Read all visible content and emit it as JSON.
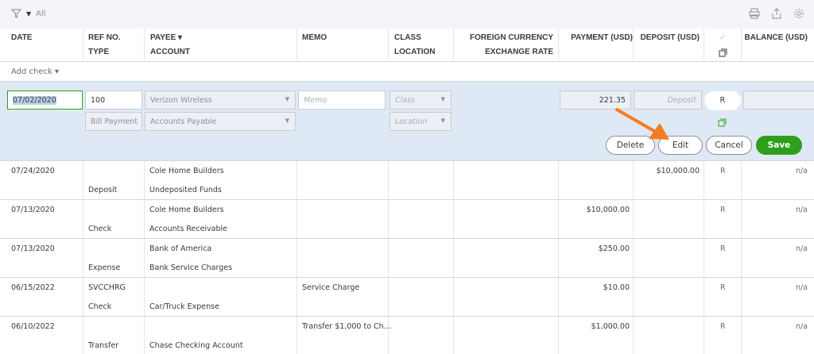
{
  "toolbar": {
    "filter_label": "All",
    "icons": [
      "filter-icon",
      "print-icon",
      "export-icon",
      "settings-icon"
    ]
  },
  "columns": {
    "date": "DATE",
    "ref_no": "REF NO.",
    "type": "TYPE",
    "payee": "PAYEE ▾",
    "account": "ACCOUNT",
    "memo": "MEMO",
    "class": "CLASS",
    "location": "LOCATION",
    "foreign_currency": "FOREIGN CURRENCY",
    "exchange_rate": "EXCHANGE RATE",
    "payment": "PAYMENT (USD)",
    "deposit": "DEPOSIT (USD)",
    "check_mark": "✓",
    "balance": "BALANCE (USD)"
  },
  "add_check": "Add check ▾",
  "editing": {
    "date": "07/02/2020",
    "ref_no": "100",
    "payee": "Verizon Wireless",
    "memo_placeholder": "Memo",
    "class_placeholder": "Class",
    "type": "Bill Payment",
    "account": "Accounts Payable",
    "location_placeholder": "Location",
    "payment": "221.35",
    "deposit_placeholder": "Deposit",
    "status": "R",
    "buttons": {
      "delete": "Delete",
      "edit": "Edit",
      "cancel": "Cancel",
      "save": "Save"
    },
    "accent_color": "#2ca01c",
    "arrow_color": "#f47c20"
  },
  "transactions": [
    {
      "date": "07/24/2020",
      "ref_no": "",
      "type": "Deposit",
      "payee": "Cole Home Builders",
      "account": "Undeposited Funds",
      "memo": "",
      "payment": "",
      "deposit": "$10,000.00",
      "status": "R",
      "balance": "n/a"
    },
    {
      "date": "07/13/2020",
      "ref_no": "",
      "type": "Check",
      "payee": "Cole Home Builders",
      "account": "Accounts Receivable",
      "memo": "",
      "payment": "$10,000.00",
      "deposit": "",
      "status": "R",
      "balance": "n/a"
    },
    {
      "date": "07/13/2020",
      "ref_no": "",
      "type": "Expense",
      "payee": "Bank of America",
      "account": "Bank Service Charges",
      "memo": "",
      "payment": "$250.00",
      "deposit": "",
      "status": "R",
      "balance": "n/a"
    },
    {
      "date": "06/15/2022",
      "ref_no": "SVCCHRG",
      "type": "Check",
      "payee": "",
      "account": "Car/Truck Expense",
      "memo": "Service Charge",
      "payment": "$10.00",
      "deposit": "",
      "status": "R",
      "balance": "n/a"
    },
    {
      "date": "06/10/2022",
      "ref_no": "",
      "type": "Transfer",
      "payee": "",
      "account": "Chase Checking Account",
      "memo": "Transfer $1,000 to Ch…",
      "payment": "$1,000.00",
      "deposit": "",
      "status": "R",
      "balance": "n/a"
    }
  ]
}
